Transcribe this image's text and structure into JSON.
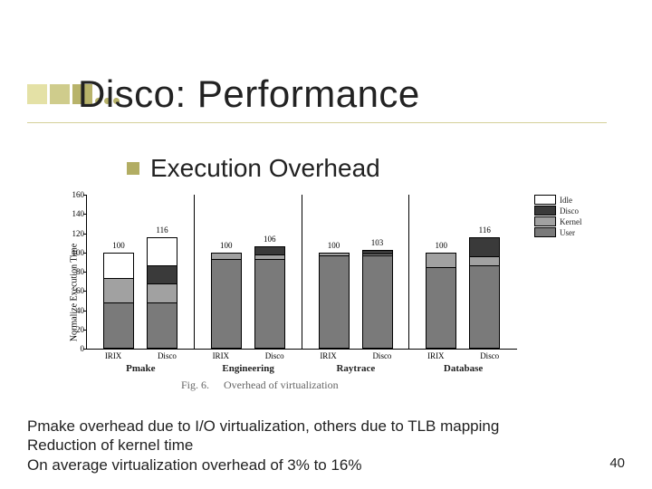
{
  "title": "Disco: Performance",
  "bullet": "Execution Overhead",
  "chart_data": {
    "type": "bar",
    "ylabel": "Normalize Execution Time",
    "ylim": [
      0,
      160
    ],
    "yticks": [
      0,
      20,
      40,
      60,
      80,
      100,
      120,
      140,
      160
    ],
    "groups": [
      "Pmake",
      "Engineering",
      "Raytrace",
      "Database"
    ],
    "systems": [
      "IRIX",
      "Disco"
    ],
    "series_order": [
      "Idle",
      "Disco",
      "Kernel",
      "User"
    ],
    "bars": [
      {
        "group": "Pmake",
        "system": "IRIX",
        "label": "100",
        "stack": {
          "Idle": 27,
          "Disco": 0,
          "Kernel": 26,
          "User": 47
        }
      },
      {
        "group": "Pmake",
        "system": "Disco",
        "label": "116",
        "stack": {
          "Idle": 30,
          "Disco": 19,
          "Kernel": 20,
          "User": 47
        }
      },
      {
        "group": "Engineering",
        "system": "IRIX",
        "label": "100",
        "stack": {
          "Idle": 0,
          "Disco": 0,
          "Kernel": 7,
          "User": 93
        }
      },
      {
        "group": "Engineering",
        "system": "Disco",
        "label": "106",
        "stack": {
          "Idle": 0,
          "Disco": 8,
          "Kernel": 5,
          "User": 93
        }
      },
      {
        "group": "Raytrace",
        "system": "IRIX",
        "label": "100",
        "stack": {
          "Idle": 0,
          "Disco": 0,
          "Kernel": 3,
          "User": 97
        }
      },
      {
        "group": "Raytrace",
        "system": "Disco",
        "label": "103",
        "stack": {
          "Idle": 0,
          "Disco": 4,
          "Kernel": 2,
          "User": 97
        }
      },
      {
        "group": "Database",
        "system": "IRIX",
        "label": "100",
        "stack": {
          "Idle": 0,
          "Disco": 0,
          "Kernel": 16,
          "User": 84
        }
      },
      {
        "group": "Database",
        "system": "Disco",
        "label": "116",
        "stack": {
          "Idle": 0,
          "Disco": 20,
          "Kernel": 10,
          "User": 86
        }
      }
    ],
    "legend": [
      "Idle",
      "Disco",
      "Kernel",
      "User"
    ]
  },
  "fig_caption_prefix": "Fig. 6.",
  "fig_caption": "Overhead of virtualization",
  "body": {
    "l1": "Pmake overhead due to I/O virtualization, others due to TLB mapping",
    "l2": "Reduction of kernel time",
    "l3": "On average virtualization overhead of 3% to 16%"
  },
  "page_number": "40"
}
